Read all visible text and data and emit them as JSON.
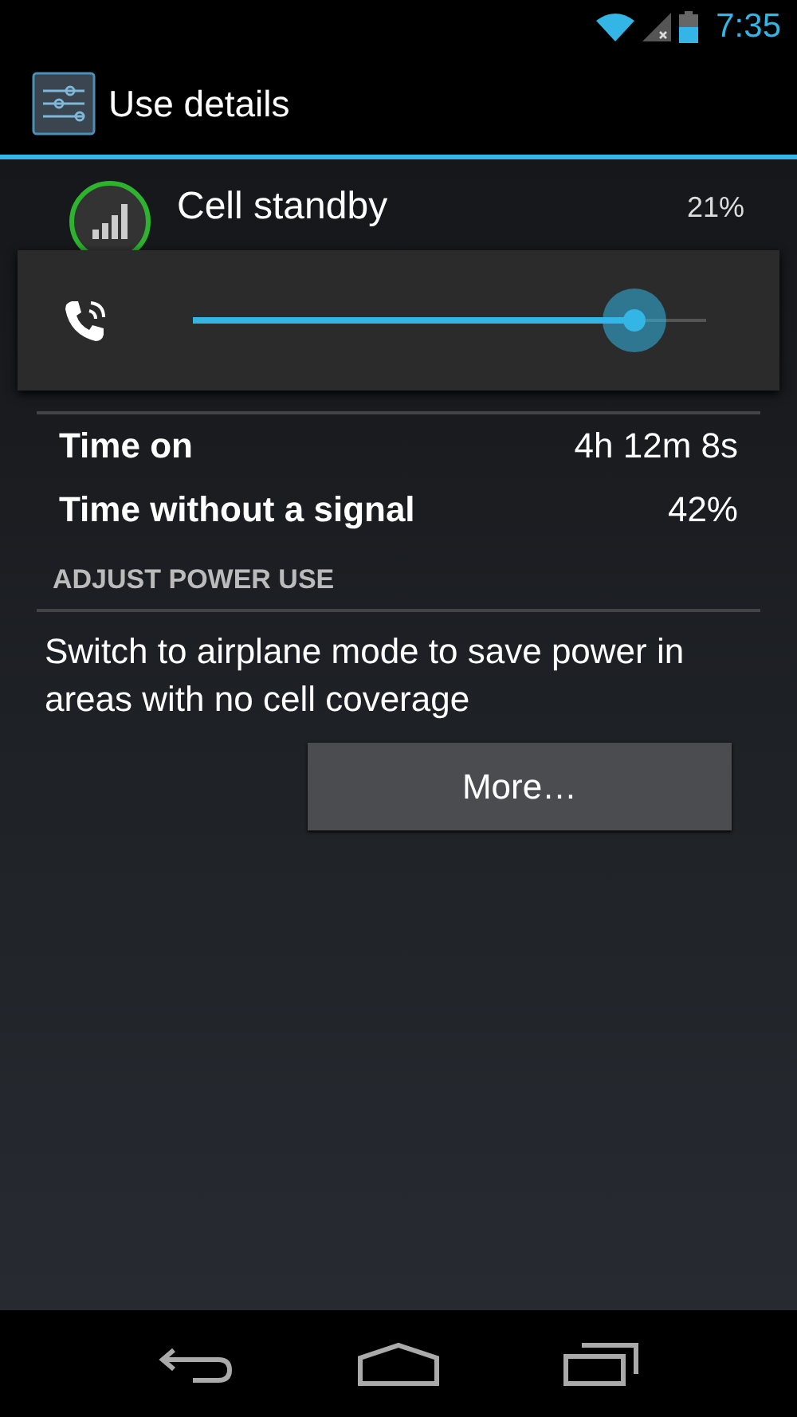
{
  "status_bar": {
    "time": "7:35"
  },
  "action_bar": {
    "title": "Use details"
  },
  "app": {
    "name": "Cell standby",
    "percent": "21%"
  },
  "volume_panel": {
    "level": 0.86
  },
  "details": [
    {
      "label": "Time on",
      "value": "4h 12m 8s"
    },
    {
      "label": "Time without a signal",
      "value": "42%"
    }
  ],
  "adjust_section": {
    "header": "ADJUST POWER USE",
    "description": "Switch to airplane mode to save power in areas with no cell coverage",
    "button": "More…"
  }
}
